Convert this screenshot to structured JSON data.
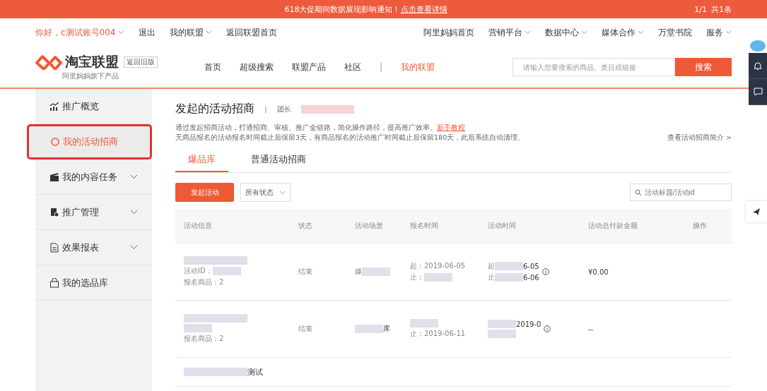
{
  "notice": {
    "text": "618大促期间数据展现影响通知！",
    "link": "点击查看详情",
    "pager": "1/1",
    "count": "共1条"
  },
  "topbar": {
    "left": [
      {
        "label": "你好，c测试账号004",
        "dropdown": true,
        "kind": "user"
      },
      {
        "label": "退出",
        "dropdown": false,
        "kind": "link"
      },
      {
        "label": "我的联盟",
        "dropdown": true,
        "kind": "link"
      },
      {
        "label": "返回联盟首页",
        "dropdown": false,
        "kind": "link"
      }
    ],
    "right": [
      {
        "label": "阿里妈妈首页",
        "dropdown": false
      },
      {
        "label": "营销平台",
        "dropdown": true
      },
      {
        "label": "数据中心",
        "dropdown": true
      },
      {
        "label": "媒体合作",
        "dropdown": true
      },
      {
        "label": "万堂书院",
        "dropdown": false
      },
      {
        "label": "服务",
        "dropdown": true
      }
    ]
  },
  "brand": {
    "name": "淘宝联盟",
    "tagline": "阿里妈妈旗下产品",
    "old_version": "返回旧版"
  },
  "nav": [
    {
      "label": "首页",
      "selected": false
    },
    {
      "label": "超级搜索",
      "selected": false
    },
    {
      "label": "联盟产品",
      "selected": false
    },
    {
      "label": "社区",
      "selected": false
    },
    {
      "label": "我的联盟",
      "selected": true
    }
  ],
  "nav_separator": "|",
  "search": {
    "placeholder": "请输入您要搜索的商品、类目或链接",
    "button": "搜索"
  },
  "sidebar": [
    {
      "label": "推广概览",
      "expandable": false,
      "selected": false
    },
    {
      "label": "我的活动招商",
      "expandable": false,
      "selected": true
    },
    {
      "label": "我的内容任务",
      "expandable": true,
      "selected": false
    },
    {
      "label": "推广管理",
      "expandable": true,
      "selected": false
    },
    {
      "label": "效果报表",
      "expandable": true,
      "selected": false
    },
    {
      "label": "我的选品库",
      "expandable": false,
      "selected": false
    }
  ],
  "page": {
    "title": "发起的活动招商",
    "separator": "|",
    "leader_label": "团长",
    "intro": "通过发起招商活动，打通招商、审核、推广全链路，简化操作路径，提高推广效率。",
    "tutorial_link": "新手教程",
    "note": "无商品报名的活动报名时间截止后保留3天，有商品报名的活动推广时间截止后保留180天，此后系统自动清理。",
    "intro_link": "查看活动招商简介 >"
  },
  "tabs": [
    {
      "label": "爆品库",
      "selected": true
    },
    {
      "label": "普通活动招商",
      "selected": false
    }
  ],
  "toolbar": {
    "create_button": "发起活动",
    "status_filter": "所有状态",
    "search_placeholder": "活动标题/活动id"
  },
  "table": {
    "columns": [
      "活动信息",
      "状态",
      "活动场景",
      "报名时间",
      "活动时间",
      "活动总付款金额",
      "操作"
    ],
    "rows": [
      {
        "info": [
          {
            "redacted": true
          },
          {
            "text": "活动ID：",
            "redacted": true
          },
          {
            "text": "报名商品：2",
            "redacted": false
          }
        ],
        "status": "结束",
        "scene": [
          {
            "text": "爆",
            "redacted": true
          }
        ],
        "signup": [
          {
            "text": "起：2019-06-05",
            "redacted": false
          },
          {
            "text": "止：",
            "redacted": true
          }
        ],
        "period": [
          {
            "text": "起",
            "redacted": true,
            "suffix": "6-05"
          },
          {
            "text": "止",
            "redacted": true,
            "suffix": "6-06"
          }
        ],
        "amount": "¥0.00"
      },
      {
        "info": [
          {
            "redacted": true
          },
          {
            "redacted": true
          },
          {
            "text": "报名商品：2",
            "redacted": false
          }
        ],
        "status": "结束",
        "scene": [
          {
            "redacted": true,
            "suffix": "库"
          }
        ],
        "signup": [
          {
            "redacted": true
          },
          {
            "text": "止：2019-06-11",
            "redacted": false
          }
        ],
        "period": [
          {
            "redacted": true,
            "suffix": "2019-0"
          },
          {
            "redacted": true
          }
        ],
        "amount": "--"
      },
      {
        "info": [
          {
            "redacted": true,
            "suffix": "测试"
          }
        ]
      }
    ]
  }
}
